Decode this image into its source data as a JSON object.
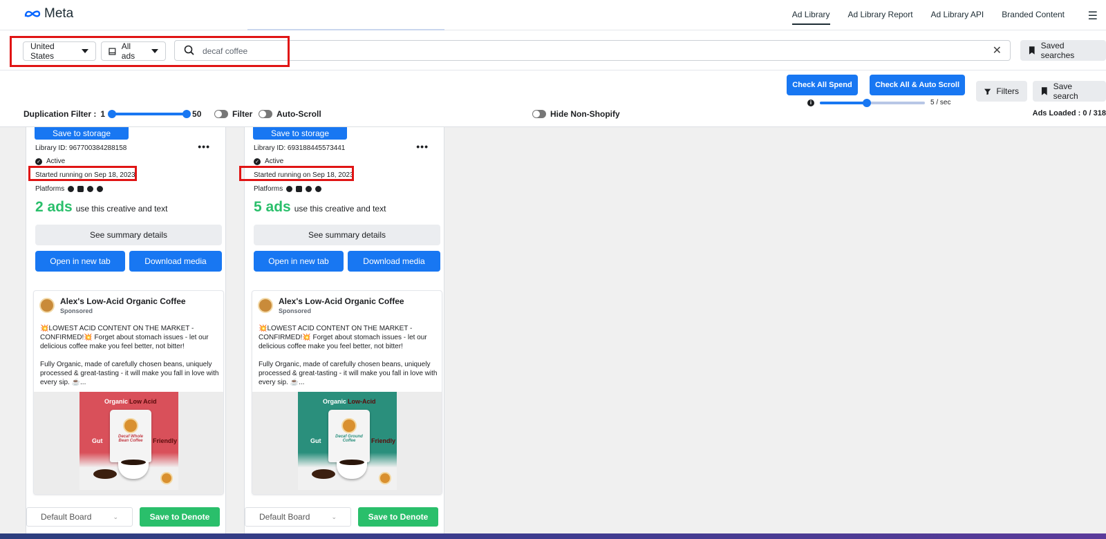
{
  "nav": {
    "brand": "Meta",
    "links": [
      "Ad Library",
      "Ad Library Report",
      "Ad Library API",
      "Branded Content"
    ]
  },
  "search": {
    "country": "United States",
    "ad_type": "All ads",
    "query": "decaf coffee",
    "saved_searches_label": "Saved searches"
  },
  "toolbar": {
    "check_all_spend": "Check All Spend",
    "check_all_auto_scroll": "Check All & Auto Scroll",
    "filters_label": "Filters",
    "save_search_label": "Save search",
    "duplication_filter_label": "Duplication Filter :",
    "dup_min": "1",
    "dup_max": "50",
    "filter_toggle_label": "Filter",
    "autoscroll_toggle_label": "Auto-Scroll",
    "hide_non_shopify_label": "Hide Non-Shopify",
    "speed_label": "5 / sec",
    "speed_fraction": 0.45,
    "ads_loaded": "Ads Loaded : 0 / 318"
  },
  "cards": [
    {
      "save_storage": "Save to storage",
      "library_id": "Library ID: 967700384288158",
      "status": "Active",
      "started": "Started running on Sep 18, 2023",
      "platforms_label": "Platforms",
      "ads_count": "2 ads",
      "ads_text": "use this creative and text",
      "summary": "See summary details",
      "open_tab": "Open in new tab",
      "download": "Download media",
      "advertiser": "Alex's Low-Acid Organic Coffee",
      "sponsored": "Sponsored",
      "body1": "💥LOWEST ACID CONTENT ON THE MARKET - CONFIRMED!💥 Forget about stomach issues - let our delicious coffee make you feel better, not bitter!",
      "body2": "Fully Organic, made of carefully chosen beans, uniquely processed & great-tasting - it will make you fall in love with every sip. ☕...",
      "media_tl": "Organic",
      "media_tr": "Low Acid",
      "media_bl": "Gut",
      "media_br": "Friendly",
      "bag_text": "Decaf Whole Bean Coffee",
      "media_color": "#d9505a",
      "board": "Default Board",
      "denote": "Save to Denote"
    },
    {
      "save_storage": "Save to storage",
      "library_id": "Library ID: 693188445573441",
      "status": "Active",
      "started": "Started running on Sep 18, 2023",
      "platforms_label": "Platforms",
      "ads_count": "5 ads",
      "ads_text": "use this creative and text",
      "summary": "See summary details",
      "open_tab": "Open in new tab",
      "download": "Download media",
      "advertiser": "Alex's Low-Acid Organic Coffee",
      "sponsored": "Sponsored",
      "body1": "💥LOWEST ACID CONTENT ON THE MARKET - CONFIRMED!💥 Forget about stomach issues - let our delicious coffee make you feel better, not bitter!",
      "body2": "Fully Organic, made of carefully chosen beans, uniquely processed & great-tasting - it will make you fall in love with every sip. ☕...",
      "media_tl": "Organic",
      "media_tr": "Low-Acid",
      "media_bl": "Gut",
      "media_br": "Friendly",
      "bag_text": "Decaf Ground Coffee",
      "media_color": "#2a8f7c",
      "board": "Default Board",
      "denote": "Save to Denote"
    }
  ],
  "colors": {
    "accent": "#1877f2",
    "green": "#2abf6b",
    "highlight": "#e01414"
  }
}
